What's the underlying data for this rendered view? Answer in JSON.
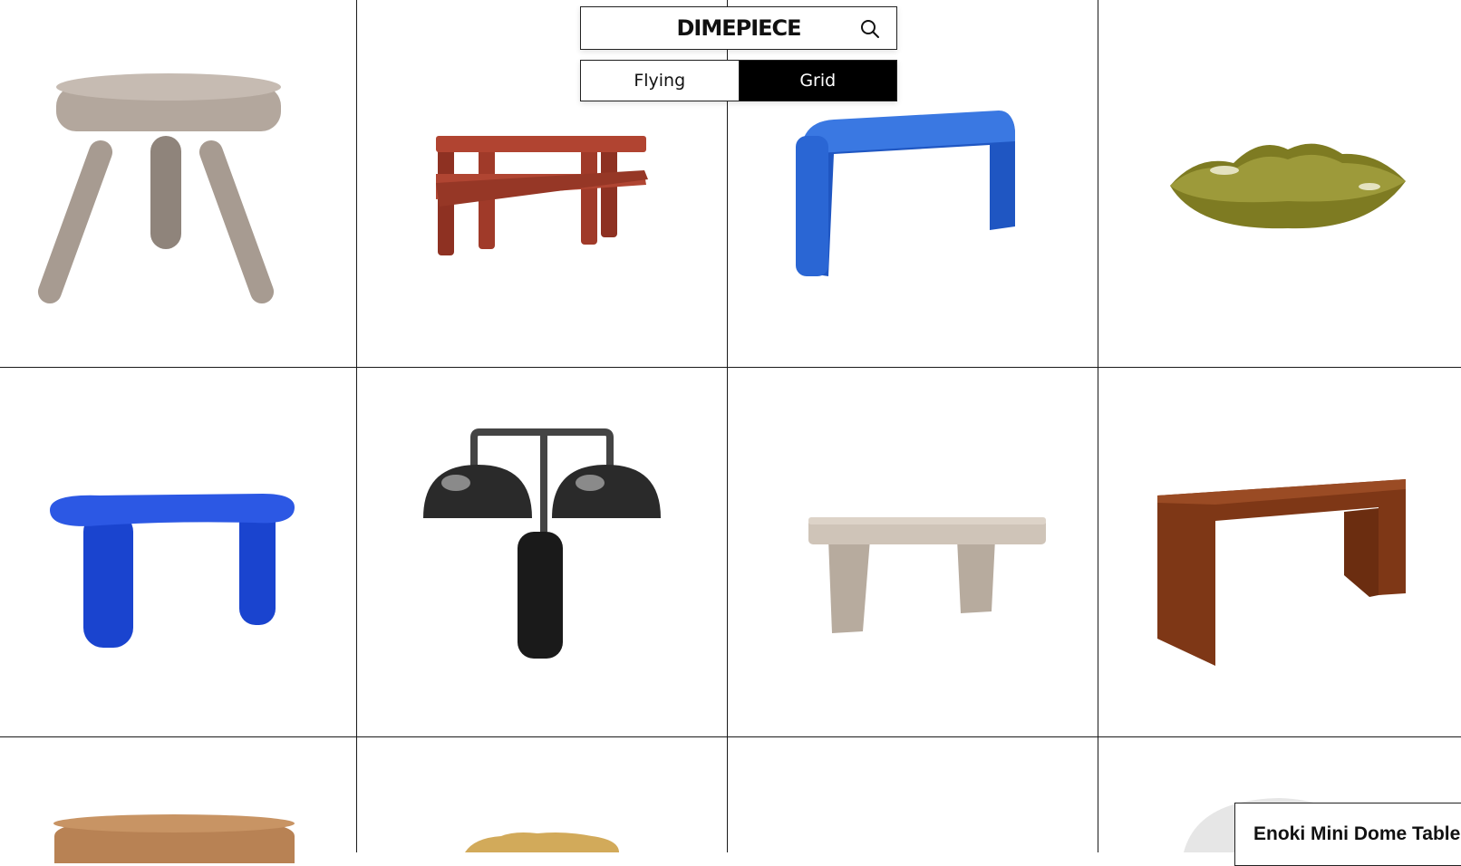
{
  "brand": {
    "title": "DIMEPIECE",
    "search_icon": "search-icon"
  },
  "view_toggle": {
    "options": [
      {
        "label": "Flying",
        "selected": false
      },
      {
        "label": "Grid",
        "selected": true
      }
    ]
  },
  "products": [
    {
      "name": "stool",
      "color": "#b6aaa0"
    },
    {
      "name": "red-shelf",
      "color": "#a8402c"
    },
    {
      "name": "blue-console",
      "color": "#2a68d4"
    },
    {
      "name": "olive-dish",
      "color": "#8c8a2e"
    },
    {
      "name": "blue-side-table",
      "color": "#1f4ee0"
    },
    {
      "name": "twin-dome-lamp",
      "color": "#2b2b2b"
    },
    {
      "name": "taupe-bench",
      "color": "#c4b8aa"
    },
    {
      "name": "brown-console",
      "color": "#8a3f1a"
    },
    {
      "name": "tan-round-table",
      "color": "#c48c5a"
    },
    {
      "name": "gold-scalloped-item",
      "color": "#d8b060"
    },
    {
      "name": "empty",
      "color": ""
    },
    {
      "name": "grey-dome-table",
      "color": "#e6e6e6"
    }
  ],
  "hover_card": {
    "title": "Enoki Mini Dome Table"
  }
}
